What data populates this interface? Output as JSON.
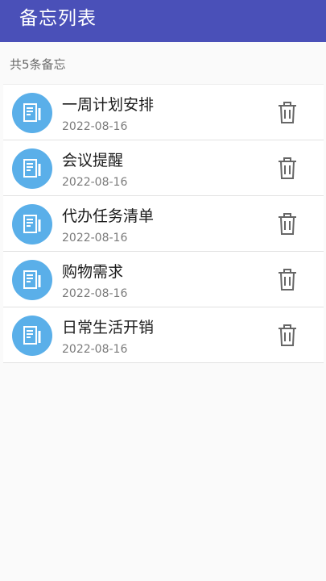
{
  "appbar": {
    "title": "备忘列表"
  },
  "summary": {
    "count_text": "共5条备忘"
  },
  "memos": [
    {
      "title": "一周计划安排",
      "date": "2022-08-16"
    },
    {
      "title": "会议提醒",
      "date": "2022-08-16"
    },
    {
      "title": "代办任务清单",
      "date": "2022-08-16"
    },
    {
      "title": "购物需求",
      "date": "2022-08-16"
    },
    {
      "title": "日常生活开销",
      "date": "2022-08-16"
    }
  ],
  "icons": {
    "memo": "memo-icon",
    "delete": "trash-icon"
  },
  "colors": {
    "appbar": "#4a50b8",
    "avatar": "#5aafe9",
    "delete_icon": "#666666"
  }
}
